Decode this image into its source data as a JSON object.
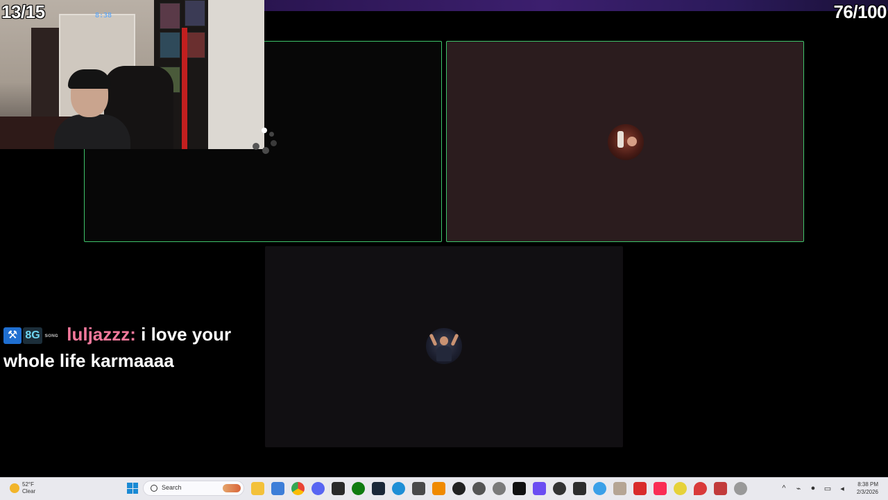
{
  "overlay": {
    "left_counter": "13/15",
    "right_counter": "76/100"
  },
  "webcam": {
    "clock_label": "8:38"
  },
  "call": {
    "tiles": [
      {
        "id": "participant-1",
        "speaking": true
      },
      {
        "id": "participant-2",
        "speaking": true
      },
      {
        "id": "participant-3",
        "speaking": false
      }
    ]
  },
  "chat": {
    "username": "luljazzz:",
    "message": "i love your whole life karmaaaa",
    "badges": [
      "⚒",
      "8G",
      "ꜱᴏɴɢ"
    ]
  },
  "taskbar": {
    "weather_temp": "52°F",
    "weather_cond": "Clear",
    "search_placeholder": "Search",
    "time": "8:38 PM",
    "date": "2/3/2026",
    "apps": [
      "file-explorer",
      "store",
      "chrome",
      "discord",
      "epic-games",
      "xbox",
      "steam",
      "edge",
      "minecraft",
      "vlc",
      "obs",
      "settings",
      "app-red",
      "app-dark",
      "app-purple-grid",
      "app-circle",
      "app-terminal",
      "app-blue",
      "app-figure",
      "app-red-2",
      "apple-music",
      "app-yellow-face",
      "app-pin",
      "app-doc",
      "app-gear"
    ],
    "tray_icons": [
      "chevron-up",
      "network-off",
      "mic",
      "monitor",
      "volume"
    ]
  }
}
